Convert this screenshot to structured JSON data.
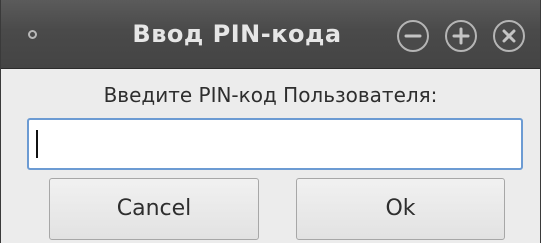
{
  "window": {
    "title": "Ввод PIN-кода"
  },
  "dialog": {
    "prompt": "Введите PIN-код Пользователя:",
    "pin_input": {
      "value": "",
      "placeholder": ""
    },
    "cancel_label": "Cancel",
    "ok_label": "Ok"
  },
  "colors": {
    "titlebar": "#4a4a4a",
    "title_text": "#e6e6e6",
    "window_bg": "#ececec",
    "input_focus_border": "#6c9bd3"
  },
  "icons": {
    "window_menu": "window-menu-dot-icon",
    "minimize": "minimize-icon",
    "maximize": "maximize-icon",
    "close": "close-icon"
  }
}
